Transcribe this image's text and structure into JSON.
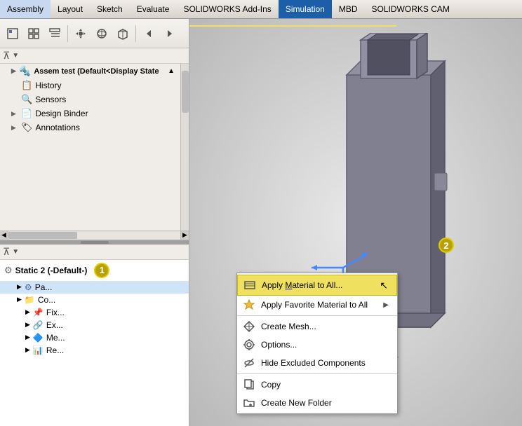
{
  "menubar": {
    "items": [
      {
        "label": "Assembly",
        "active": false
      },
      {
        "label": "Layout",
        "active": false
      },
      {
        "label": "Sketch",
        "active": false
      },
      {
        "label": "Evaluate",
        "active": false
      },
      {
        "label": "SOLIDWORKS Add-Ins",
        "active": false
      },
      {
        "label": "Simulation",
        "active": true
      },
      {
        "label": "MBD",
        "active": false
      },
      {
        "label": "SOLIDWORKS CAM",
        "active": false
      }
    ]
  },
  "feature_tree": {
    "root_label": "Assem test  (Default<Display State",
    "items": [
      {
        "label": "History",
        "icon": "📋",
        "indent": 1,
        "expand": false
      },
      {
        "label": "Sensors",
        "icon": "🔍",
        "indent": 1,
        "expand": false
      },
      {
        "label": "Design Binder",
        "icon": "📎",
        "indent": 1,
        "expand": false
      },
      {
        "label": "Annotations",
        "icon": "🏷",
        "indent": 1,
        "expand": false
      }
    ]
  },
  "simulation_panel": {
    "study_label": "Static 2 (-Default-)",
    "badge1": "1",
    "badge2": "2",
    "items": [
      {
        "label": "Pa...",
        "icon": "gear",
        "indent": 1,
        "selected": true
      },
      {
        "label": "Co...",
        "icon": "folder",
        "indent": 1
      },
      {
        "label": "Fix...",
        "icon": "fix",
        "indent": 2
      },
      {
        "label": "Ex...",
        "icon": "ext",
        "indent": 2
      },
      {
        "label": "Me...",
        "icon": "mesh",
        "indent": 2
      },
      {
        "label": "Re...",
        "icon": "result",
        "indent": 2
      }
    ]
  },
  "context_menu": {
    "items": [
      {
        "label": "Apply Material to All...",
        "icon": "list",
        "highlighted": true,
        "has_arrow": false
      },
      {
        "label": "Apply Favorite Material to All",
        "icon": "star",
        "highlighted": false,
        "has_arrow": true
      },
      {
        "label": "Create Mesh...",
        "icon": "mesh",
        "highlighted": false,
        "has_arrow": false
      },
      {
        "label": "Options...",
        "icon": "gear",
        "highlighted": false,
        "has_arrow": false
      },
      {
        "label": "Hide Excluded Components",
        "icon": "hide",
        "highlighted": false,
        "has_arrow": false
      },
      {
        "separator": true
      },
      {
        "label": "Copy",
        "icon": "copy",
        "highlighted": false,
        "has_arrow": false
      },
      {
        "label": "Create New Folder",
        "icon": "folder",
        "highlighted": false,
        "has_arrow": false
      }
    ]
  },
  "icons": {
    "filter": "▼",
    "expand_right": "▶",
    "expand_down": "▼",
    "arrow_right": "▶",
    "cursor": "↖"
  }
}
